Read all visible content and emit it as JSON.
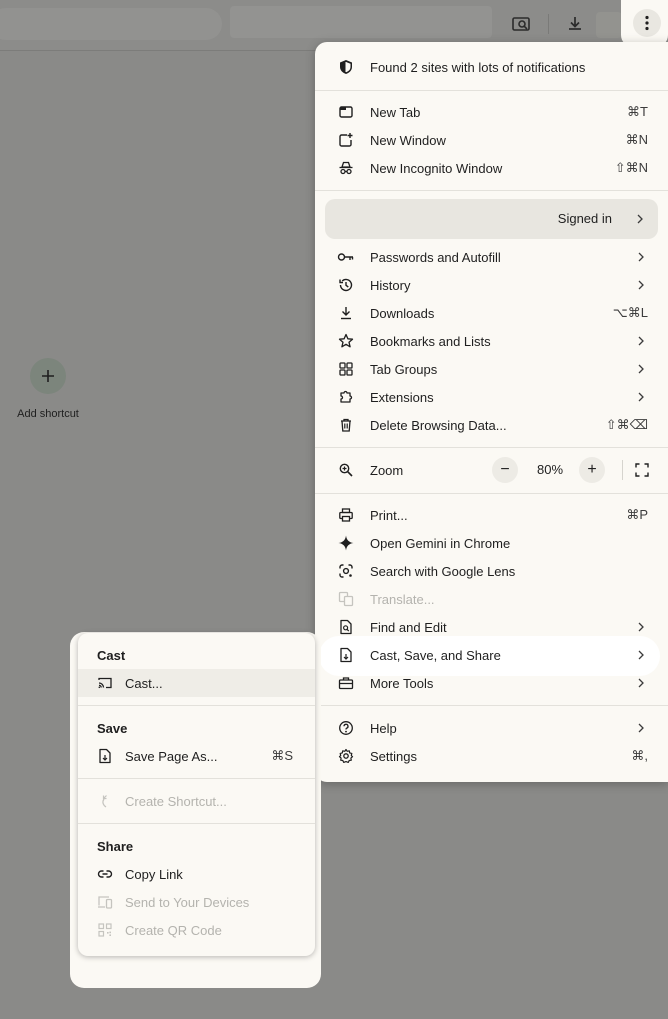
{
  "toolbar": {
    "icons": [
      "search-tab-icon",
      "download-icon",
      "kebab-menu-icon"
    ]
  },
  "ntp": {
    "add_shortcut_label": "Add shortcut"
  },
  "menu": {
    "notification_banner": "Found 2 sites with lots of notifications",
    "new_tab": {
      "label": "New Tab",
      "shortcut": "⌘T"
    },
    "new_window": {
      "label": "New Window",
      "shortcut": "⌘N"
    },
    "new_incognito": {
      "label": "New Incognito Window",
      "shortcut": "⇧⌘N"
    },
    "profile_status": "Signed in",
    "passwords": {
      "label": "Passwords and Autofill"
    },
    "history": {
      "label": "History"
    },
    "downloads": {
      "label": "Downloads",
      "shortcut": "⌥⌘L"
    },
    "bookmarks": {
      "label": "Bookmarks and Lists"
    },
    "tab_groups": {
      "label": "Tab Groups"
    },
    "extensions": {
      "label": "Extensions"
    },
    "delete_data": {
      "label": "Delete Browsing Data...",
      "shortcut": "⇧⌘⌫"
    },
    "zoom": {
      "label": "Zoom",
      "minus": "−",
      "value": "80%",
      "plus": "+"
    },
    "print": {
      "label": "Print...",
      "shortcut": "⌘P"
    },
    "gemini": {
      "label": "Open Gemini in Chrome"
    },
    "lens": {
      "label": "Search with Google Lens"
    },
    "translate": {
      "label": "Translate..."
    },
    "find_edit": {
      "label": "Find and Edit"
    },
    "cast_save_share": {
      "label": "Cast, Save, and Share"
    },
    "more_tools": {
      "label": "More Tools"
    },
    "help": {
      "label": "Help"
    },
    "settings": {
      "label": "Settings",
      "shortcut": "⌘,"
    }
  },
  "submenu": {
    "cast_heading": "Cast",
    "cast": {
      "label": "Cast..."
    },
    "save_heading": "Save",
    "save_page": {
      "label": "Save Page As...",
      "shortcut": "⌘S"
    },
    "create_shortcut": {
      "label": "Create Shortcut..."
    },
    "share_heading": "Share",
    "copy_link": {
      "label": "Copy Link"
    },
    "send_devices": {
      "label": "Send to Your Devices"
    },
    "qr_code": {
      "label": "Create QR Code"
    }
  },
  "colors": {
    "menu_bg": "#fbf9f4",
    "overlay": "#8a8a88",
    "disabled_text": "#b4b3ae",
    "text": "#1f1f1f"
  }
}
